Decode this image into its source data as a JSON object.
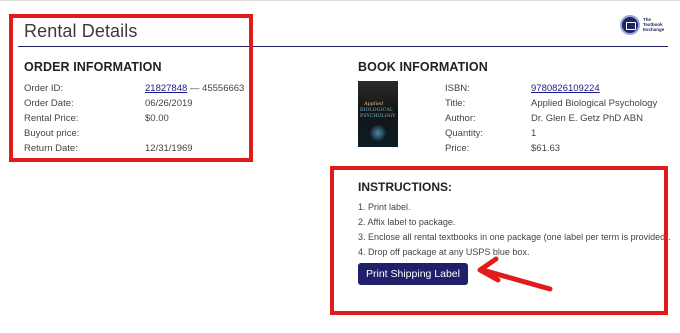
{
  "header": {
    "title": "Rental Details",
    "logo_text": "The Textbook Exchange"
  },
  "order": {
    "heading": "ORDER INFORMATION",
    "rows": [
      {
        "label": "Order ID:",
        "link": "21827848",
        "suffix": " — 45556663"
      },
      {
        "label": "Order Date:",
        "value": "06/26/2019"
      },
      {
        "label": "Rental Price:",
        "value": "$0.00"
      },
      {
        "label": "Buyout price:",
        "value": ""
      },
      {
        "label": "Return Date:",
        "value": "12/31/1969"
      }
    ]
  },
  "book": {
    "heading": "BOOK INFORMATION",
    "cover": {
      "line1": "Applied",
      "line2": "BIOLOGICAL",
      "line3": "PSYCHOLOGY"
    },
    "rows": [
      {
        "label": "ISBN:",
        "value": "9780826109224"
      },
      {
        "label": "Title:",
        "value": "Applied Biological Psychology"
      },
      {
        "label": "Author:",
        "value": "Dr. Glen E. Getz PhD ABN"
      },
      {
        "label": "Quantity:",
        "value": "1"
      },
      {
        "label": "Price:",
        "value": "$61.63"
      }
    ]
  },
  "instructions": {
    "heading": "INSTRUCTIONS:",
    "items": [
      "1. Print label.",
      "2. Affix label to package.",
      "3. Enclose all rental textbooks in one package (one label per term is provided).",
      "4. Drop off package at any USPS blue box."
    ],
    "button_label": "Print Shipping Label"
  },
  "colors": {
    "accent": "#1f2069",
    "annotation": "#e11b1b",
    "link": "#1a1a8c"
  }
}
